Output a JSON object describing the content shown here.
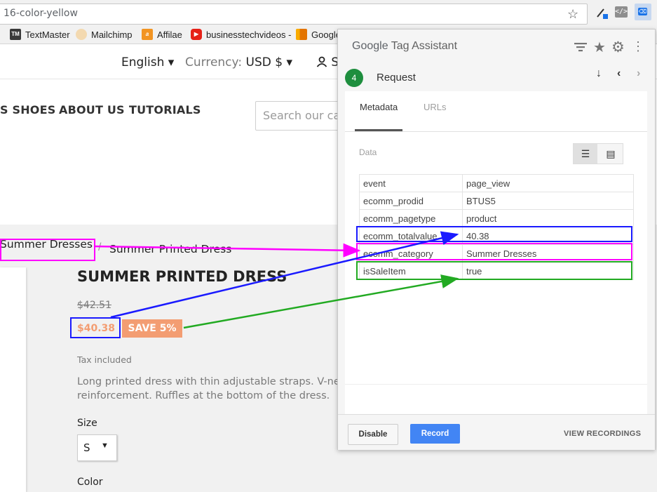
{
  "browser": {
    "url": "16-color-yellow",
    "bookmarks": [
      {
        "label": "TextMaster",
        "icon": "textmaster-icon",
        "abbr": "TM"
      },
      {
        "label": "Mailchimp",
        "icon": "mailchimp-icon",
        "abbr": ""
      },
      {
        "label": "Affilae",
        "icon": "affilae-icon",
        "abbr": "a"
      },
      {
        "label": "businesstechvideos -",
        "icon": "youtube-icon",
        "abbr": "▶"
      },
      {
        "label": "Google",
        "icon": "google-analytics-icon",
        "abbr": ""
      }
    ]
  },
  "site": {
    "language": "English",
    "currency_label": "Currency:",
    "currency_value": "USD $",
    "account_initial": "S",
    "nav": [
      "S SHOES",
      "ABOUT US",
      "TUTORIALS"
    ],
    "search_placeholder": "Search our cat"
  },
  "product": {
    "breadcrumb": [
      "Summer Dresses",
      "Summer Printed Dress"
    ],
    "breadcrumb_sep": "/",
    "title": "SUMMER PRINTED DRESS",
    "old_price": "$42.51",
    "price": "$40.38",
    "discount": "SAVE 5%",
    "tax_note": "Tax included",
    "description_line1": "Long printed dress with thin adjustable straps. V-nec",
    "description_line2": "reinforcement. Ruffles at the bottom of the dress.",
    "size_label": "Size",
    "size_value": "S",
    "color_label": "Color"
  },
  "tag_assistant": {
    "title_brand": "Google",
    "title_rest": "Tag Assistant",
    "request_number": "4",
    "request_label": "Request",
    "tabs": [
      "Metadata",
      "URLs"
    ],
    "data_label": "Data",
    "rows": [
      {
        "key": "event",
        "value": "page_view"
      },
      {
        "key": "ecomm_prodid",
        "value": "BTUS5"
      },
      {
        "key": "ecomm_pagetype",
        "value": "product"
      },
      {
        "key": "ecomm_totalvalue",
        "value": "40.38"
      },
      {
        "key": "ecomm_category",
        "value": "Summer Dresses"
      },
      {
        "key": "isSaleItem",
        "value": "true"
      }
    ],
    "buttons": {
      "disable": "Disable",
      "record": "Record",
      "recordings": "VIEW RECORDINGS"
    }
  },
  "annotation_colors": {
    "category": "#ff00ff",
    "price": "#1a1aff",
    "sale": "#22aa22"
  },
  "colors": {
    "accent_price": "#f39d72",
    "record_button": "#4285f4",
    "request_badge": "#1e8e3e"
  }
}
